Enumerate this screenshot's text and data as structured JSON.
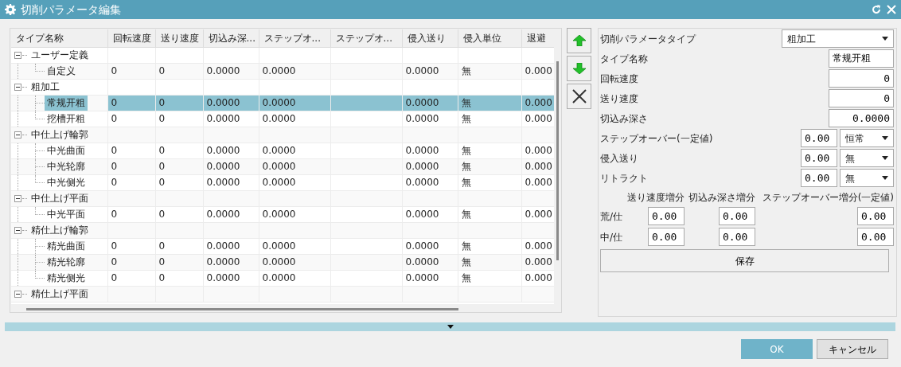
{
  "window": {
    "title": "切削パラメータ編集"
  },
  "table": {
    "columns": [
      "タイプ名称",
      "回転速度",
      "送り速度",
      "切込み深...",
      "ステップオ...",
      "ステップオ...",
      "侵入送り",
      "侵入単位",
      "退避"
    ],
    "rows": [
      {
        "name": "ユーザー定義",
        "expanded": true,
        "selected": false,
        "children": [
          {
            "name": "自定义",
            "selected": false,
            "cells": [
              "0",
              "0",
              "0.0000",
              "0.0000",
              "",
              "0.0000",
              "無",
              "0.000"
            ]
          }
        ]
      },
      {
        "name": "粗加工",
        "expanded": true,
        "selected": false,
        "children": [
          {
            "name": "常规开粗",
            "selected": true,
            "cells": [
              "0",
              "0",
              "0.0000",
              "0.0000",
              "",
              "0.0000",
              "無",
              "0.000"
            ]
          },
          {
            "name": "挖槽开粗",
            "selected": false,
            "cells": [
              "0",
              "0",
              "0.0000",
              "0.0000",
              "",
              "0.0000",
              "無",
              "0.000"
            ]
          }
        ]
      },
      {
        "name": "中仕上げ輪郭",
        "expanded": true,
        "selected": false,
        "children": [
          {
            "name": "中光曲面",
            "selected": false,
            "cells": [
              "0",
              "0",
              "0.0000",
              "0.0000",
              "",
              "0.0000",
              "無",
              "0.000"
            ]
          },
          {
            "name": "中光轮廓",
            "selected": false,
            "cells": [
              "0",
              "0",
              "0.0000",
              "0.0000",
              "",
              "0.0000",
              "無",
              "0.000"
            ]
          },
          {
            "name": "中光侧光",
            "selected": false,
            "cells": [
              "0",
              "0",
              "0.0000",
              "0.0000",
              "",
              "0.0000",
              "無",
              "0.000"
            ]
          }
        ]
      },
      {
        "name": "中仕上げ平面",
        "expanded": true,
        "selected": false,
        "children": [
          {
            "name": "中光平面",
            "selected": false,
            "cells": [
              "0",
              "0",
              "0.0000",
              "0.0000",
              "",
              "0.0000",
              "無",
              "0.000"
            ]
          }
        ]
      },
      {
        "name": "精仕上げ輪郭",
        "expanded": true,
        "selected": false,
        "children": [
          {
            "name": "精光曲面",
            "selected": false,
            "cells": [
              "0",
              "0",
              "0.0000",
              "0.0000",
              "",
              "0.0000",
              "無",
              "0.000"
            ]
          },
          {
            "name": "精光轮廓",
            "selected": false,
            "cells": [
              "0",
              "0",
              "0.0000",
              "0.0000",
              "",
              "0.0000",
              "無",
              "0.000"
            ]
          },
          {
            "name": "精光侧光",
            "selected": false,
            "cells": [
              "0",
              "0",
              "0.0000",
              "0.0000",
              "",
              "0.0000",
              "無",
              "0.000"
            ]
          }
        ]
      },
      {
        "name": "精仕上げ平面",
        "expanded": true,
        "selected": false
      }
    ]
  },
  "form": {
    "fields": [
      {
        "kind": "select",
        "label": "切削パラメータタイプ",
        "value": "粗加工"
      },
      {
        "kind": "text",
        "label": "タイプ名称",
        "value": "常规开粗"
      },
      {
        "kind": "number",
        "label": "回転速度",
        "value": "0"
      },
      {
        "kind": "number",
        "label": "送り速度",
        "value": "0"
      },
      {
        "kind": "number",
        "label": "切込み深さ",
        "value": "0.0000"
      },
      {
        "kind": "number_select",
        "label": "ステップオーバー(一定値)",
        "value": "0.00",
        "option": "恒常"
      },
      {
        "kind": "number_select",
        "label": "侵入送り",
        "value": "0.00",
        "option": "無"
      },
      {
        "kind": "number_select",
        "label": "リトラクト",
        "value": "0.00",
        "option": "無"
      }
    ],
    "increment_headers": [
      "送り速度増分",
      "切込み深さ増分",
      "ステップオーバー増分(一定値)"
    ],
    "increment_rows": [
      {
        "label": "荒/仕",
        "values": [
          "0.00",
          "0.00",
          "0.00"
        ]
      },
      {
        "label": "中/仕",
        "values": [
          "0.00",
          "0.00",
          "0.00"
        ]
      }
    ],
    "save_button": "保存"
  },
  "footer": {
    "buttons": [
      {
        "label": "OK",
        "kind": "primary"
      },
      {
        "label": "キャンセル",
        "kind": "secondary"
      }
    ]
  }
}
